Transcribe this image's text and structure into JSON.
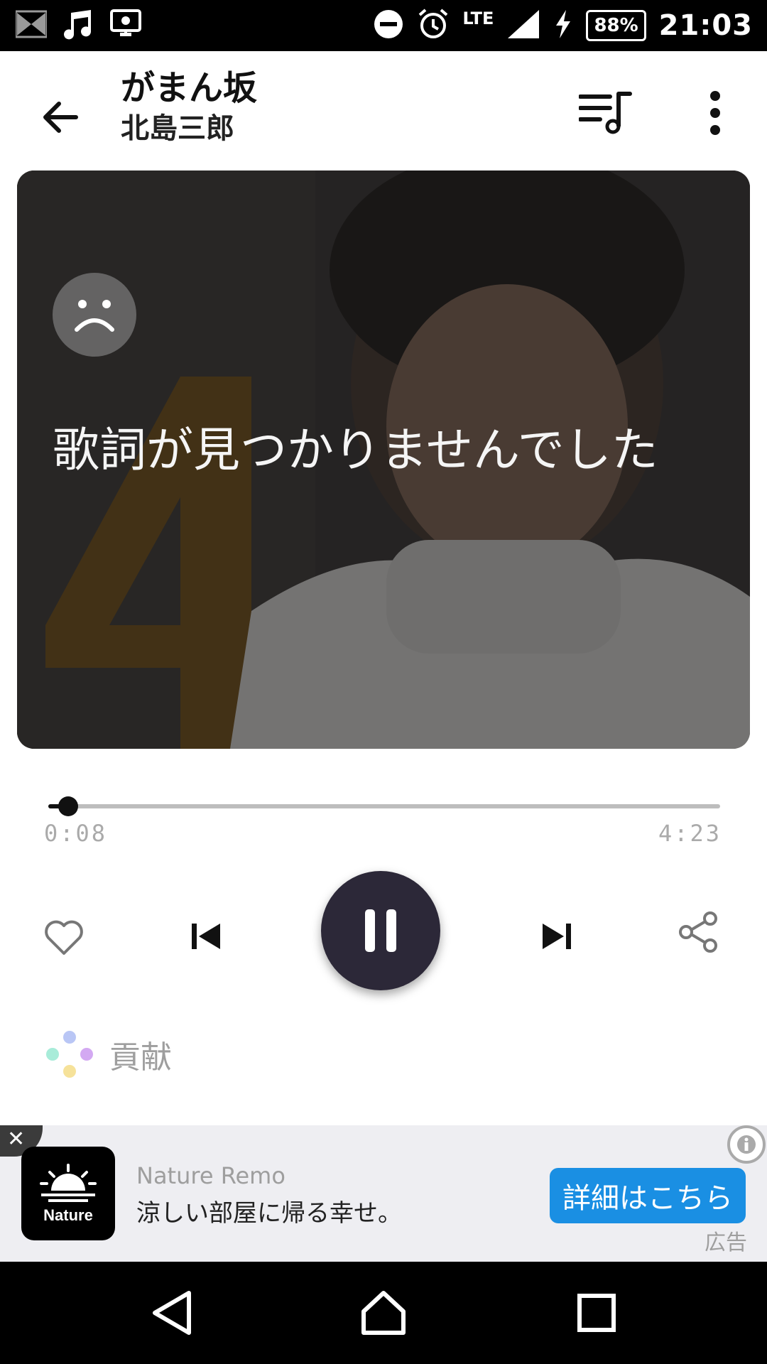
{
  "status_bar": {
    "icons": [
      "tv-icon",
      "music-note-icon",
      "cast-icon",
      "do-not-disturb-icon",
      "alarm-icon",
      "signal-icon",
      "charging-icon"
    ],
    "network": "LTE",
    "battery": "88%",
    "time": "21:03"
  },
  "header": {
    "title": "がまん坂",
    "artist": "北島三郎"
  },
  "lyrics": {
    "message": "歌詞が見つかりませんでした"
  },
  "player": {
    "elapsed": "0:08",
    "total": "4:23",
    "progress": 0.03,
    "state": "playing"
  },
  "contribute": {
    "label": "貢献"
  },
  "ad": {
    "brand": "Nature Remo",
    "copy": "涼しい部屋に帰る幸せ。",
    "cta": "詳細はこちら",
    "label": "広告",
    "logo_text": "Nature",
    "cta_color": "#1a8fe3"
  },
  "colors": {
    "play_button": "#2c2838",
    "accent": "#111111"
  }
}
